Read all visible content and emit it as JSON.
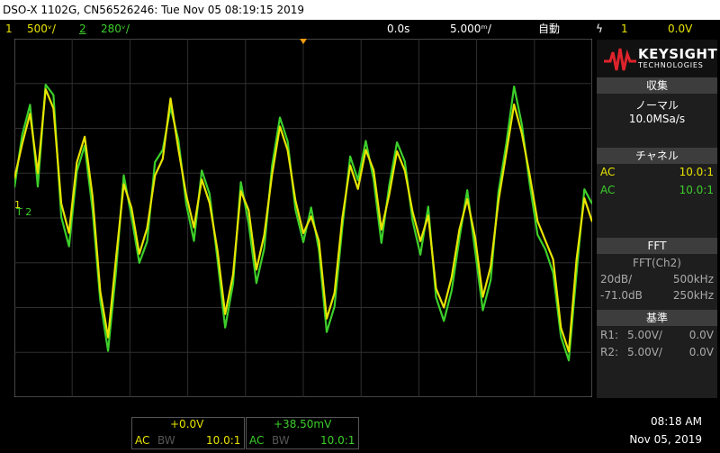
{
  "title": "DSO-X 1102G, CN56526246: Tue Nov 05 08:19:15 2019",
  "topbar": {
    "ch1_num": "1",
    "ch1_scale": "500ᵛ/",
    "ch2_num": "2",
    "ch2_scale": "280ᵛ/",
    "time_offset": "0.0s",
    "time_scale": "5.000ᵐ/",
    "trigger_mode": "自動",
    "trigger_icon": "ϟ",
    "trigger_channel": "1",
    "trigger_level": "0.0V"
  },
  "panel": {
    "brand": "KEYSIGHT",
    "brand_sub": "TECHNOLOGIES",
    "acq_header": "収集",
    "acq_mode": "ノーマル",
    "acq_rate": "10.0MSa/s",
    "chan_header": "チャネル",
    "ch1_coupling": "AC",
    "ch1_probe": "10.0:1",
    "ch2_coupling": "AC",
    "ch2_probe": "10.0:1",
    "fft_header": "FFT",
    "fft_source": "FFT(Ch2)",
    "fft_scale": "20dB/",
    "fft_span": "500kHz",
    "fft_ref": "-71.0dB",
    "fft_center": "250kHz",
    "ref_header": "基準",
    "r1_label": "R1:",
    "r1_scale": "5.00V/",
    "r1_offset": "0.0V",
    "r2_label": "R2:",
    "r2_scale": "5.00V/",
    "r2_offset": "0.0V"
  },
  "bottom": {
    "ch1_offset": "+0.0V",
    "ch1_coupling": "AC",
    "ch1_bw": "BW",
    "ch1_probe": "10.0:1",
    "ch2_offset": "+38.50mV",
    "ch2_coupling": "AC",
    "ch2_bw": "BW",
    "ch2_probe": "10.0:1",
    "time": "08:18 AM",
    "date": "Nov 05, 2019"
  },
  "colors": {
    "ch1": "#e8e400",
    "ch2": "#3ccf2a",
    "grid": "#2f2f2f",
    "panel_bg": "#1e1e1e",
    "trigger": "#f39c12"
  },
  "chart_data": {
    "type": "line",
    "x_divisions": 10,
    "y_divisions": 8,
    "series": [
      {
        "name": "1",
        "values": [
          0.8,
          1.6,
          2.3,
          1.0,
          2.9,
          2.5,
          0.4,
          -0.4,
          1.2,
          1.8,
          0.5,
          -1.6,
          -2.6,
          -1.0,
          0.7,
          0.2,
          -0.8,
          -0.2,
          1.0,
          1.4,
          2.6,
          1.5,
          0.5,
          -0.2,
          0.9,
          0.4,
          -0.8,
          -2.2,
          -1.3,
          0.6,
          0.2,
          -1.1,
          -0.3,
          0.9,
          2.0,
          1.5,
          0.4,
          -0.3,
          0.1,
          -0.6,
          -2.3,
          -1.7,
          0.0,
          1.2,
          0.7,
          1.6,
          1.0,
          -0.3,
          0.5,
          1.5,
          1.1,
          0.2,
          -0.6,
          0.0,
          -1.6,
          -2.0,
          -1.3,
          -0.2,
          0.5,
          -0.5,
          -1.8,
          -1.1,
          0.4,
          1.5,
          2.6,
          1.8,
          0.9,
          -0.1,
          -0.5,
          -0.9,
          -2.4,
          -2.9,
          -1.0,
          0.4,
          -0.1
        ],
        "color": "#e8e400"
      },
      {
        "name": "2",
        "values": [
          0.6,
          1.8,
          2.5,
          0.7,
          3.0,
          2.8,
          0.1,
          -0.7,
          1.0,
          1.6,
          0.2,
          -1.8,
          -2.9,
          -1.3,
          0.9,
          0.0,
          -1.0,
          -0.5,
          1.3,
          1.6,
          2.4,
          1.7,
          0.3,
          -0.5,
          1.1,
          0.6,
          -1.0,
          -2.5,
          -1.5,
          0.8,
          -0.1,
          -1.4,
          -0.6,
          1.1,
          2.2,
          1.7,
          0.2,
          -0.5,
          0.3,
          -0.8,
          -2.6,
          -2.0,
          -0.2,
          1.4,
          0.9,
          1.8,
          0.8,
          -0.6,
          0.7,
          1.7,
          1.3,
          0.0,
          -0.9,
          0.2,
          -1.8,
          -2.3,
          -1.6,
          -0.4,
          0.7,
          -0.8,
          -2.1,
          -1.4,
          0.6,
          1.7,
          3.0,
          2.0,
          0.7,
          -0.4,
          -0.7,
          -1.2,
          -2.6,
          -3.1,
          -1.3,
          0.6,
          0.3
        ],
        "color": "#3ccf2a"
      }
    ]
  }
}
